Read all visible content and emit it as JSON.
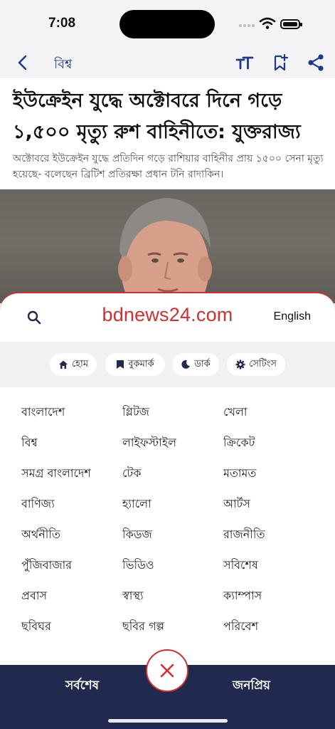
{
  "status": {
    "time": "7:08"
  },
  "nav": {
    "title": "বিশ্ব",
    "icons": {
      "back": "chevron-left-icon",
      "text_size": "text-size-icon",
      "bookmark": "bookmark-add-icon",
      "share": "share-icon"
    }
  },
  "article": {
    "headline": "ইউক্রেইন যুদ্ধে অক্টোবরে দিনে গড়ে ১,৫০০ মৃত্যু রুশ বাহিনীতে: যুক্তরাজ্য",
    "summary": "অক্টোবরে ইউক্রেইন যুদ্ধে প্রতিদিন গড়ে রাশিয়ার বাহিনীর প্রায় ১৫০০ সেনা মৃত্যু হয়েছে- বলেছেন ব্রিটিশ প্রতিরক্ষা প্রধান টনি রাদাকিন।"
  },
  "menu": {
    "logo": "bdnews24.com",
    "language": "English",
    "quick_links": [
      {
        "label": "হোম",
        "icon": "home-icon"
      },
      {
        "label": "বুকমার্ক",
        "icon": "bookmark-icon"
      },
      {
        "label": "ডার্ক",
        "icon": "moon-icon"
      },
      {
        "label": "সেটিংস",
        "icon": "gear-icon"
      }
    ],
    "categories": [
      [
        "বাংলাদেশ",
        "গ্লিটজ",
        "খেলা"
      ],
      [
        "বিশ্ব",
        "লাইফস্টাইল",
        "ক্রিকেট"
      ],
      [
        "সমগ্র বাংলাদেশ",
        "টেক",
        "মতামত"
      ],
      [
        "বাণিজ্য",
        "হ্যালো",
        "আর্টস"
      ],
      [
        "অর্থনীতি",
        "কিডজ",
        "রাজনীতি"
      ],
      [
        "পুঁজিবাজার",
        "ভিডিও",
        "সবিশেষ"
      ],
      [
        "প্রবাস",
        "স্বাস্থ্য",
        "ক্যাম্পাস"
      ],
      [
        "ছবিঘর",
        "ছবির গল্প",
        "পরিবেশ"
      ]
    ]
  },
  "bottom": {
    "left": "সর্বশেষ",
    "right": "জনপ্রিয়"
  },
  "colors": {
    "brand_red": "#d32f2f",
    "nav_blue": "#1d3a8a",
    "bottom_bar": "#1f2a4e"
  }
}
